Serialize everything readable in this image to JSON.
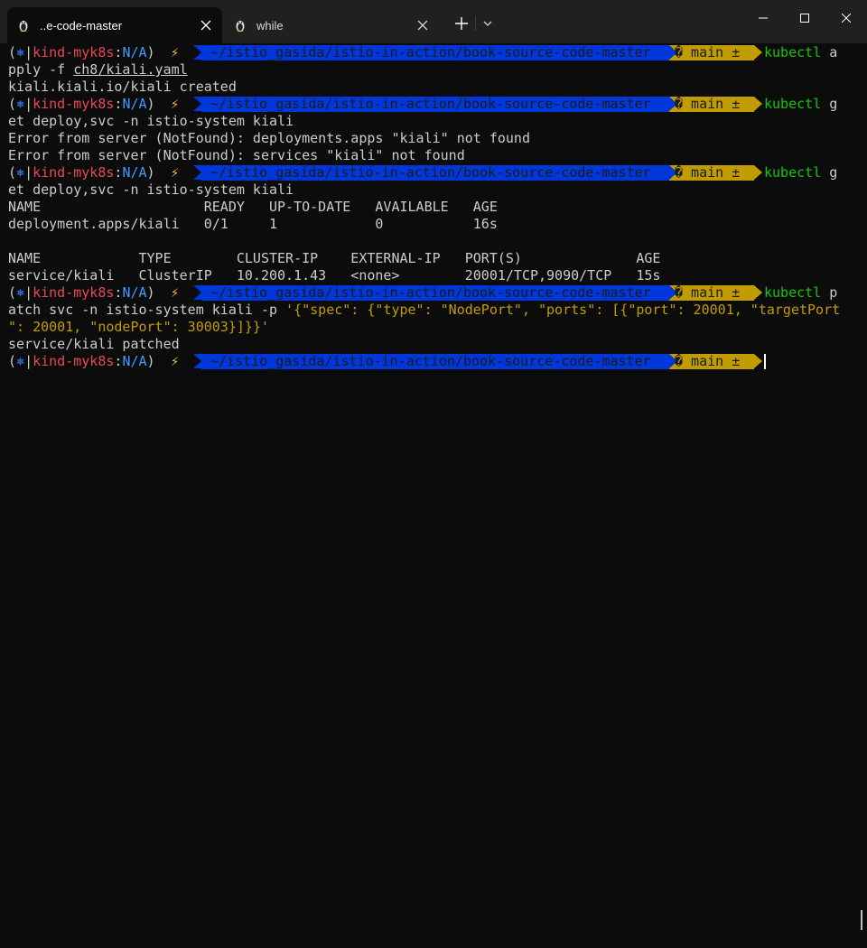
{
  "tabs": [
    {
      "label": "..e-code-master",
      "icon": "tux-icon",
      "active": true
    },
    {
      "label": "while",
      "icon": "tux-icon",
      "active": false
    }
  ],
  "prompt": {
    "open_paren": "(",
    "k8s_glyph": "⎈",
    "separator": "|",
    "context": "kind-myk8s",
    "colon": ":",
    "namespace": "N/A",
    "close_paren": ")",
    "bolt": "⚡",
    "path": "~/istio_gasida/istio-in-action/book-source-code-master",
    "git": "� main ±"
  },
  "commands": [
    {
      "exe": "kubectl",
      "rest": " a",
      "wrap": "pply -f ",
      "arg": "ch8/kiali.yaml"
    },
    {
      "exe": "kubectl",
      "rest": " g",
      "wrap": "et deploy,svc -n istio-system kiali"
    },
    {
      "exe": "kubectl",
      "rest": " g",
      "wrap": "et deploy,svc -n istio-system kiali"
    },
    {
      "exe": "kubectl",
      "rest": " p",
      "wrap": "atch svc -n istio-system kiali -p ",
      "json1": "'{\"spec\": {\"type\": \"NodePort\", \"ports\": [{\"port\": 20001, \"targetPort",
      "json2": "\": 20001, \"nodePort\": 30003}]}}'"
    }
  ],
  "output": {
    "created": "kiali.kiali.io/kiali created",
    "error1": "Error from server (NotFound): deployments.apps \"kiali\" not found",
    "error2": "Error from server (NotFound): services \"kiali\" not found",
    "deploy_header": "NAME                    READY   UP-TO-DATE   AVAILABLE   AGE",
    "deploy_row": "deployment.apps/kiali   0/1     1            0           16s",
    "svc_header": "NAME            TYPE        CLUSTER-IP    EXTERNAL-IP   PORT(S)              AGE",
    "svc_row": "service/kiali   ClusterIP   10.200.1.43   <none>        20001/TCP,9090/TCP   15s",
    "patched": "service/kiali patched"
  },
  "colors": {
    "background": "#0c0c0c",
    "path_bg": "#0037da",
    "git_bg": "#c19c00",
    "exe": "#16c60c",
    "context": "#e74856"
  }
}
